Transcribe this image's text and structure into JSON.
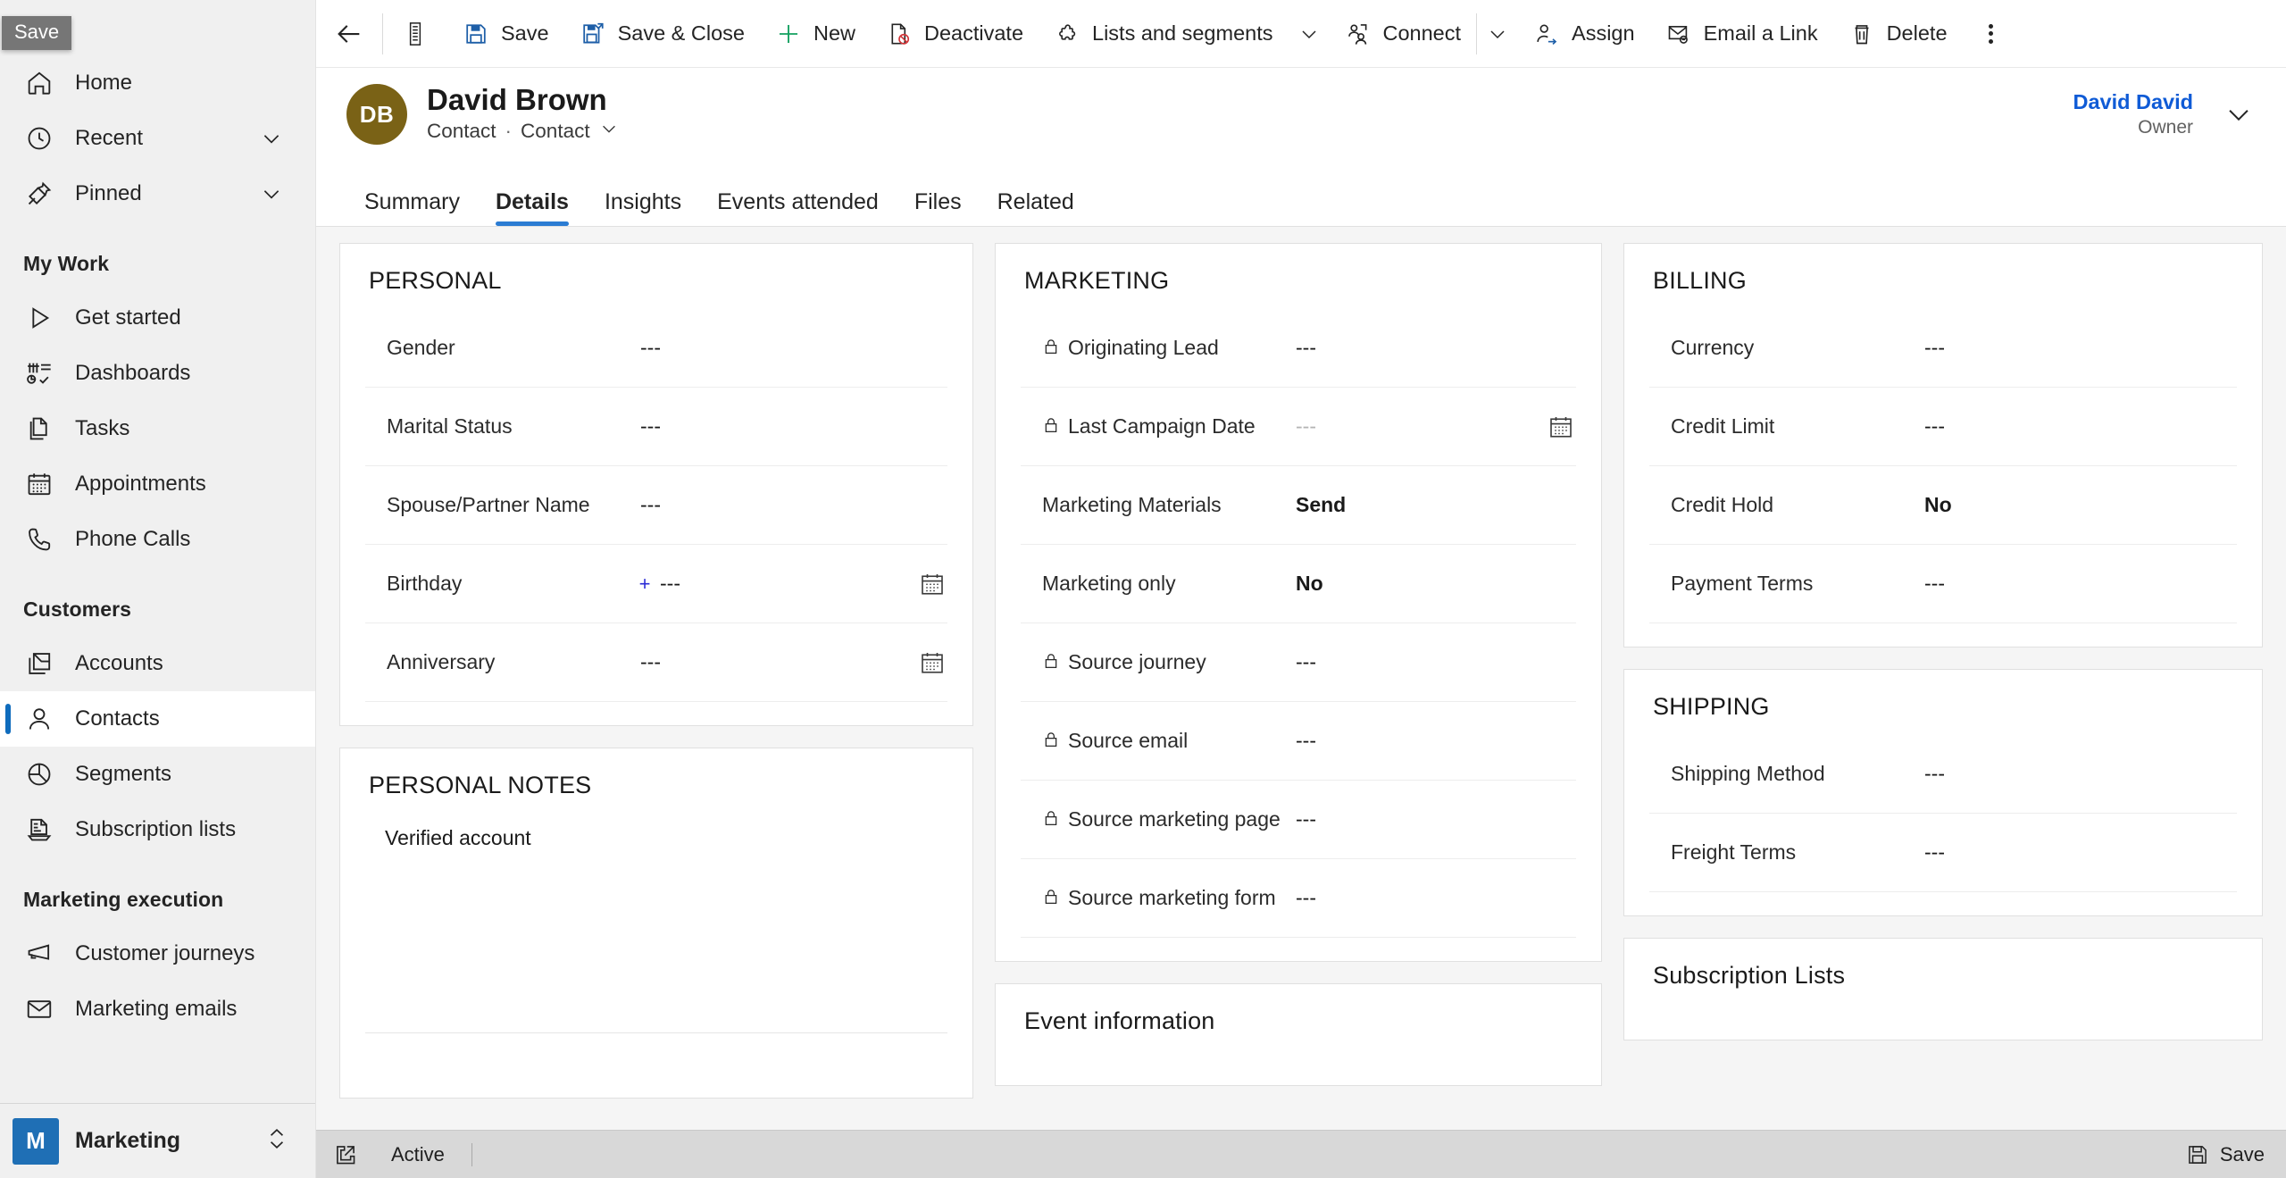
{
  "tooltip": {
    "text": "Save"
  },
  "sidebar": {
    "top_items": [
      {
        "label": "Home",
        "icon": "home-icon",
        "chevron": false
      },
      {
        "label": "Recent",
        "icon": "clock-icon",
        "chevron": true
      },
      {
        "label": "Pinned",
        "icon": "pin-icon",
        "chevron": true
      }
    ],
    "groups": [
      {
        "title": "My Work",
        "items": [
          {
            "label": "Get started",
            "icon": "play-icon"
          },
          {
            "label": "Dashboards",
            "icon": "dashboard-icon"
          },
          {
            "label": "Tasks",
            "icon": "tasks-icon"
          },
          {
            "label": "Appointments",
            "icon": "calendar-icon"
          },
          {
            "label": "Phone Calls",
            "icon": "phone-icon"
          }
        ]
      },
      {
        "title": "Customers",
        "items": [
          {
            "label": "Accounts",
            "icon": "accounts-icon"
          },
          {
            "label": "Contacts",
            "icon": "contact-icon",
            "selected": true
          },
          {
            "label": "Segments",
            "icon": "segments-icon"
          },
          {
            "label": "Subscription lists",
            "icon": "subscription-list-icon"
          }
        ]
      },
      {
        "title": "Marketing execution",
        "items": [
          {
            "label": "Customer journeys",
            "icon": "megaphone-icon"
          },
          {
            "label": "Marketing emails",
            "icon": "envelope-icon"
          }
        ]
      }
    ],
    "app_switcher": {
      "initial": "M",
      "name": "Marketing"
    }
  },
  "commandbar": {
    "back_icon": "back-arrow-icon",
    "form_selector_icon": "form-list-icon",
    "buttons": [
      {
        "label": "Save",
        "icon": "save-icon"
      },
      {
        "label": "Save & Close",
        "icon": "save-close-icon"
      },
      {
        "label": "New",
        "icon": "plus-icon"
      },
      {
        "label": "Deactivate",
        "icon": "deactivate-icon"
      },
      {
        "label": "Lists and segments",
        "icon": "puzzle-icon",
        "chevron": true
      },
      {
        "label": "Connect",
        "icon": "connect-icon",
        "divider_after": true,
        "chevron": true
      },
      {
        "label": "Assign",
        "icon": "assign-icon"
      },
      {
        "label": "Email a Link",
        "icon": "email-link-icon"
      },
      {
        "label": "Delete",
        "icon": "trash-icon"
      }
    ],
    "overflow_icon": "more-vertical-icon"
  },
  "record": {
    "avatar_initials": "DB",
    "name": "David Brown",
    "entity_type": "Contact",
    "form_name": "Contact",
    "owner_name": "David David",
    "owner_label": "Owner"
  },
  "tabs": [
    {
      "label": "Summary",
      "active": false
    },
    {
      "label": "Details",
      "active": true
    },
    {
      "label": "Insights",
      "active": false
    },
    {
      "label": "Events attended",
      "active": false
    },
    {
      "label": "Files",
      "active": false
    },
    {
      "label": "Related",
      "active": false
    }
  ],
  "sections": {
    "personal": {
      "title": "PERSONAL",
      "fields": [
        {
          "label": "Gender",
          "value": "---"
        },
        {
          "label": "Marital Status",
          "value": "---"
        },
        {
          "label": "Spouse/Partner Name",
          "value": "---"
        },
        {
          "label": "Birthday",
          "value": "---",
          "calendar": true,
          "plus": "+"
        },
        {
          "label": "Anniversary",
          "value": "---",
          "calendar": true
        }
      ]
    },
    "personal_notes": {
      "title": "PERSONAL NOTES",
      "value": "Verified account"
    },
    "marketing": {
      "title": "MARKETING",
      "fields": [
        {
          "label": "Originating Lead",
          "value": "---",
          "locked": true
        },
        {
          "label": "Last Campaign Date",
          "value": "---",
          "locked": true,
          "calendar": true,
          "dim": true
        },
        {
          "label": "Marketing Materials",
          "value": "Send",
          "bold": true
        },
        {
          "label": "Marketing only",
          "value": "No",
          "bold": true
        },
        {
          "label": "Source journey",
          "value": "---",
          "locked": true
        },
        {
          "label": "Source email",
          "value": "---",
          "locked": true
        },
        {
          "label": "Source marketing page",
          "value": "---",
          "locked": true
        },
        {
          "label": "Source marketing form",
          "value": "---",
          "locked": true
        }
      ]
    },
    "event_information": {
      "title": "Event information"
    },
    "billing": {
      "title": "BILLING",
      "fields": [
        {
          "label": "Currency",
          "value": "---"
        },
        {
          "label": "Credit Limit",
          "value": "---"
        },
        {
          "label": "Credit Hold",
          "value": "No",
          "bold": true
        },
        {
          "label": "Payment Terms",
          "value": "---"
        }
      ]
    },
    "shipping": {
      "title": "SHIPPING",
      "fields": [
        {
          "label": "Shipping Method",
          "value": "---"
        },
        {
          "label": "Freight Terms",
          "value": "---"
        }
      ]
    },
    "subscription_lists": {
      "title": "Subscription Lists"
    }
  },
  "footer": {
    "popout_icon": "open-in-new-icon",
    "status": "Active",
    "save_label": "Save",
    "save_icon": "save-icon"
  },
  "colors": {
    "accent": "#2b7cd3",
    "link": "#0f5bd6",
    "avatar": "#7a6216",
    "app_badge": "#1f6fb5",
    "sidebar_bg": "#f0f0f0",
    "form_bg": "#f5f5f5"
  }
}
